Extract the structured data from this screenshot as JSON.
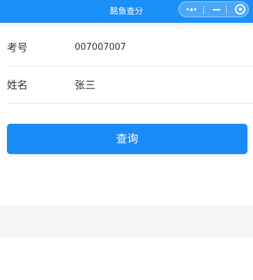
{
  "navbar": {
    "title": "酩鱼查分",
    "background": "#1b8ff8",
    "capsule": {
      "more_icon": "more-dots-icon",
      "minimize_icon": "minimize-icon",
      "close_icon": "target-close-icon"
    }
  },
  "form": {
    "fields": [
      {
        "label": "考号",
        "value": "007007007"
      },
      {
        "label": "姓名",
        "value": "张三"
      }
    ],
    "submit_label": "查询",
    "accent": "#1a8cf8"
  }
}
